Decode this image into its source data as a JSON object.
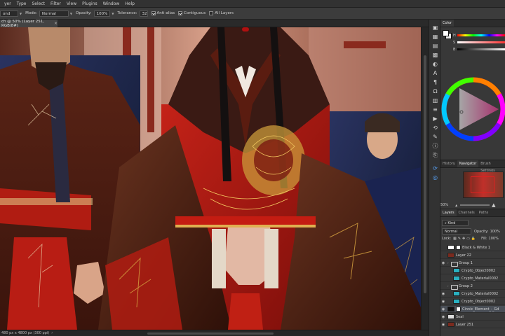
{
  "menu": [
    "yer",
    "Type",
    "Select",
    "Filter",
    "View",
    "Plugins",
    "Window",
    "Help"
  ],
  "options_bar": {
    "mode_label": "Mode:",
    "mode_value": "Normal",
    "tool_preset_value": "ond",
    "opacity_label": "Opacity:",
    "opacity_value": "100%",
    "tolerance_label": "Tolerance:",
    "tolerance_value": "32",
    "anti_alias_label": "Anti-alias",
    "anti_alias_checked": true,
    "contiguous_label": "Contiguous",
    "contiguous_checked": true,
    "all_layers_label": "All Layers",
    "all_layers_checked": false
  },
  "document_tab": {
    "title": "ch @ 50% (Layer 251, RGB/8#)",
    "close_glyph": "×"
  },
  "status_bar": {
    "text": "480 px x 4800 px (300 ppi)",
    "arrow": "›"
  },
  "color_panel": {
    "tab": "Color",
    "slider_labels": [
      "H",
      "S",
      "B"
    ],
    "fg_color": "#ffffff",
    "bg_color": "#e8e8e8"
  },
  "history_panel": {
    "tabs": [
      "History",
      "Navigator",
      "Brush Settings"
    ],
    "active_tab": "Navigator",
    "zoom": "50%"
  },
  "layers_panel": {
    "tabs": [
      "Layers",
      "Channels",
      "Paths"
    ],
    "kind_label": "Kind",
    "blend_mode": "Normal",
    "opacity_label": "Opacity:",
    "opacity_value": "100%",
    "lock_label": "Lock:",
    "fill_label": "Fill:",
    "fill_value": "100%",
    "layers": [
      {
        "name": "Black & White 1",
        "visible": false,
        "type": "adjustment",
        "indent": 0,
        "selected": false
      },
      {
        "name": "Layer 22",
        "visible": false,
        "type": "pixel",
        "indent": 0,
        "selected": false
      },
      {
        "name": "Group 1",
        "visible": true,
        "type": "group",
        "indent": 0,
        "selected": false
      },
      {
        "name": "Crypto_Object0002",
        "visible": false,
        "type": "pixel",
        "indent": 1,
        "selected": false
      },
      {
        "name": "Crypto_Material0002",
        "visible": false,
        "type": "pixel",
        "indent": 1,
        "selected": false
      },
      {
        "name": "Group 2",
        "visible": false,
        "type": "group",
        "indent": 0,
        "selected": false
      },
      {
        "name": "Crypto_Material0002",
        "visible": true,
        "type": "pixel",
        "indent": 1,
        "selected": false
      },
      {
        "name": "Crypto_Object0002",
        "visible": true,
        "type": "pixel",
        "indent": 1,
        "selected": false
      },
      {
        "name": "Cinnic_Element_-_Gd",
        "visible": true,
        "type": "masked",
        "indent": 0,
        "selected": true
      },
      {
        "name": "Seal",
        "visible": true,
        "type": "pixel",
        "indent": 0,
        "selected": false
      },
      {
        "name": "Layer 251",
        "visible": true,
        "type": "pixel",
        "indent": 0,
        "selected": false
      }
    ]
  },
  "icons": {
    "strip": [
      "color-picker-icon",
      "swatches-icon",
      "gradient-icon",
      "patterns-icon",
      "adjustments-icon",
      "character-icon",
      "paragraph-icon",
      "glyphs-icon",
      "libraries-icon",
      "properties-icon",
      "actions-icon",
      "history-icon",
      "brush-icon",
      "info-icon",
      "clone-source-icon",
      "rotate-icon",
      "circle-icon"
    ]
  },
  "colors": {
    "accent_blue": "#58a6ff",
    "panel_bg": "#383838",
    "robe_red": "#b81d14",
    "gold": "#d4a040"
  }
}
